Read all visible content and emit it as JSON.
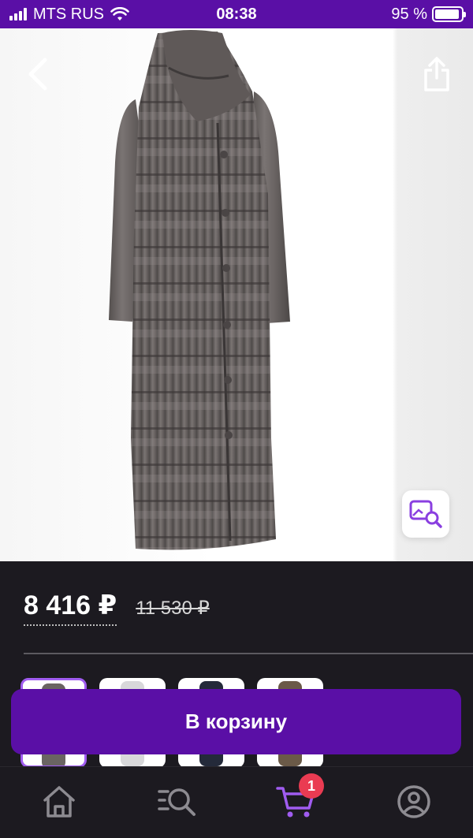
{
  "status_bar": {
    "carrier": "MTS RUS",
    "time": "08:38",
    "battery": "95 %",
    "battery_level": 0.95
  },
  "product": {
    "image_icon": "grey-quilted-long-down-coat",
    "actions": {
      "back_icon": "back-chevron-icon",
      "favorite_icon": "heart-icon",
      "share_icon": "share-icon",
      "visual_search_icon": "image-search-icon"
    }
  },
  "price": {
    "current": "8 416 ₽",
    "old": "11 530 ₽"
  },
  "swatches": [
    {
      "color": "#6a6462",
      "selected": true
    },
    {
      "color": "#d8d8da",
      "selected": false
    },
    {
      "color": "#242a3a",
      "selected": false
    },
    {
      "color": "#6b5a48",
      "selected": false
    }
  ],
  "cart_button": {
    "label": "В корзину"
  },
  "tab_bar": {
    "tabs": [
      {
        "icon": "home-icon",
        "active": false
      },
      {
        "icon": "catalog-search-icon",
        "active": false
      },
      {
        "icon": "cart-icon",
        "active": true,
        "badge": "1"
      },
      {
        "icon": "profile-icon",
        "active": false
      }
    ]
  },
  "colors": {
    "brand_purple": "#5a0fa6",
    "accent_purple": "#a05cf0",
    "badge_red": "#ea3b52",
    "dark_background": "#1c1a20"
  }
}
